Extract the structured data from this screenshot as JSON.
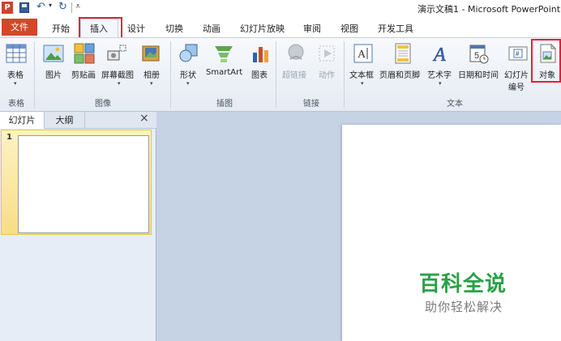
{
  "app": {
    "logo_letter": "P",
    "title": "演示文稿1 - Microsoft PowerPoint"
  },
  "quick_access": {
    "undo": "↶",
    "redo": "↻",
    "customize": "⩡"
  },
  "tabs": {
    "file": "文件",
    "home": "开始",
    "insert": "插入",
    "design": "设计",
    "transitions": "切换",
    "animations": "动画",
    "slideshow": "幻灯片放映",
    "review": "审阅",
    "view": "视图",
    "developer": "开发工具"
  },
  "ribbon": {
    "table": "表格",
    "picture": "图片",
    "clipart": "剪贴画",
    "screenshot": "屏幕截图",
    "album": "相册",
    "shapes": "形状",
    "smartart": "SmartArt",
    "chart": "图表",
    "hyperlink": "超链接",
    "action": "动作",
    "textbox": "文本框",
    "header_footer": "页眉和页脚",
    "wordart": "艺术字",
    "datetime": "日期和时间",
    "slide_number_1": "幻灯片",
    "slide_number_2": "编号",
    "object": "对象",
    "date_icon_num": "5",
    "num_icon": "#"
  },
  "groups": {
    "tables": "表格",
    "images": "图像",
    "illustrations": "插图",
    "links": "链接",
    "text": "文本"
  },
  "panel": {
    "tab_slides": "幻灯片",
    "tab_outline": "大纲",
    "close": "×",
    "slide_number": "1"
  },
  "watermark": {
    "title": "百科全说",
    "subtitle": "助你轻松解决"
  }
}
